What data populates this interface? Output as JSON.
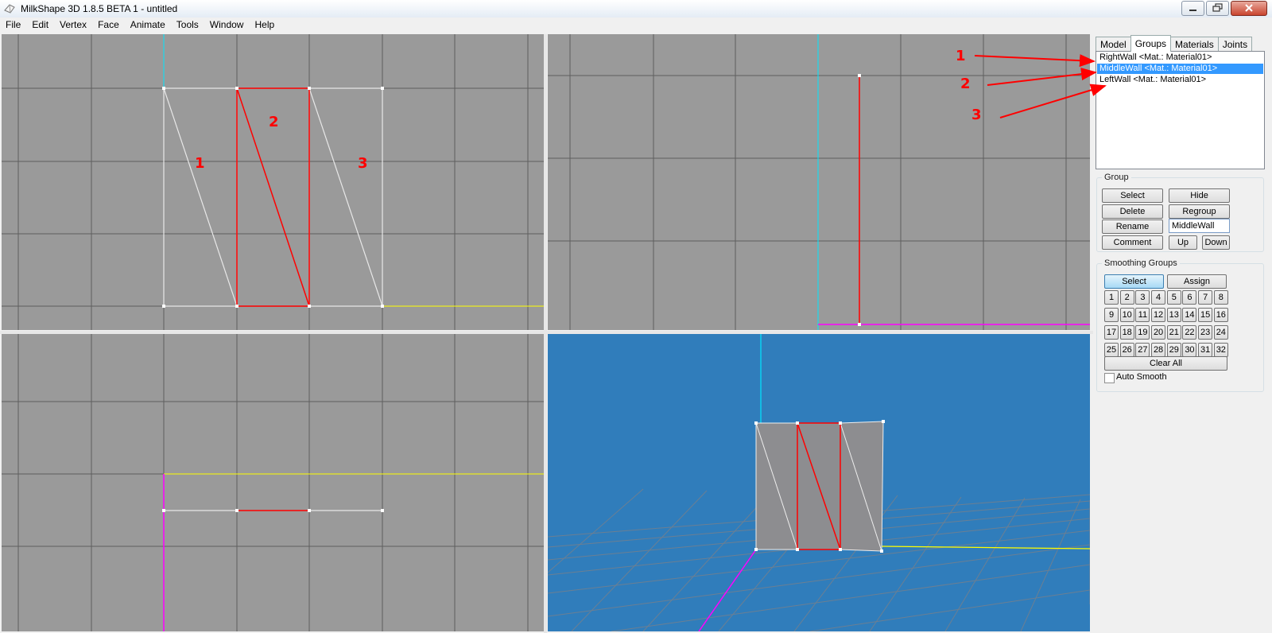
{
  "window": {
    "title": "MilkShape 3D 1.8.5 BETA 1 - untitled"
  },
  "menu": [
    "File",
    "Edit",
    "Vertex",
    "Face",
    "Animate",
    "Tools",
    "Window",
    "Help"
  ],
  "viewports": {
    "top_left": {
      "annotations": [
        "1",
        "2",
        "3"
      ]
    }
  },
  "panel": {
    "tabs": [
      "Model",
      "Groups",
      "Materials",
      "Joints"
    ],
    "active_tab": "Groups",
    "groups_list": [
      {
        "label": "RightWall <Mat.: Material01>",
        "selected": false
      },
      {
        "label": "MiddleWall <Mat.: Material01>",
        "selected": true
      },
      {
        "label": "LeftWall <Mat.: Material01>",
        "selected": false
      }
    ],
    "list_annotations": [
      "1",
      "2",
      "3"
    ],
    "group_box": {
      "title": "Group",
      "select": "Select",
      "hide": "Hide",
      "delete": "Delete",
      "regroup": "Regroup",
      "rename": "Rename",
      "name_value": "MiddleWall",
      "comment": "Comment",
      "up": "Up",
      "down": "Down"
    },
    "smoothing": {
      "title": "Smoothing Groups",
      "select": "Select",
      "assign": "Assign",
      "numbers": [
        "1",
        "2",
        "3",
        "4",
        "5",
        "6",
        "7",
        "8",
        "9",
        "10",
        "11",
        "12",
        "13",
        "14",
        "15",
        "16",
        "17",
        "18",
        "19",
        "20",
        "21",
        "22",
        "23",
        "24",
        "25",
        "26",
        "27",
        "28",
        "29",
        "30",
        "31",
        "32"
      ],
      "clear_all": "Clear All",
      "auto_smooth": "Auto Smooth",
      "auto_smooth_checked": false
    }
  },
  "colors": {
    "viewport_bg": "#9a9a9a",
    "perspective_bg": "#307dbb",
    "selected": "#ff0000",
    "axis_y": "#00e5ff",
    "axis_x": "#ffff00",
    "axis_z": "#ff00ff",
    "list_selection": "#3399ff"
  }
}
